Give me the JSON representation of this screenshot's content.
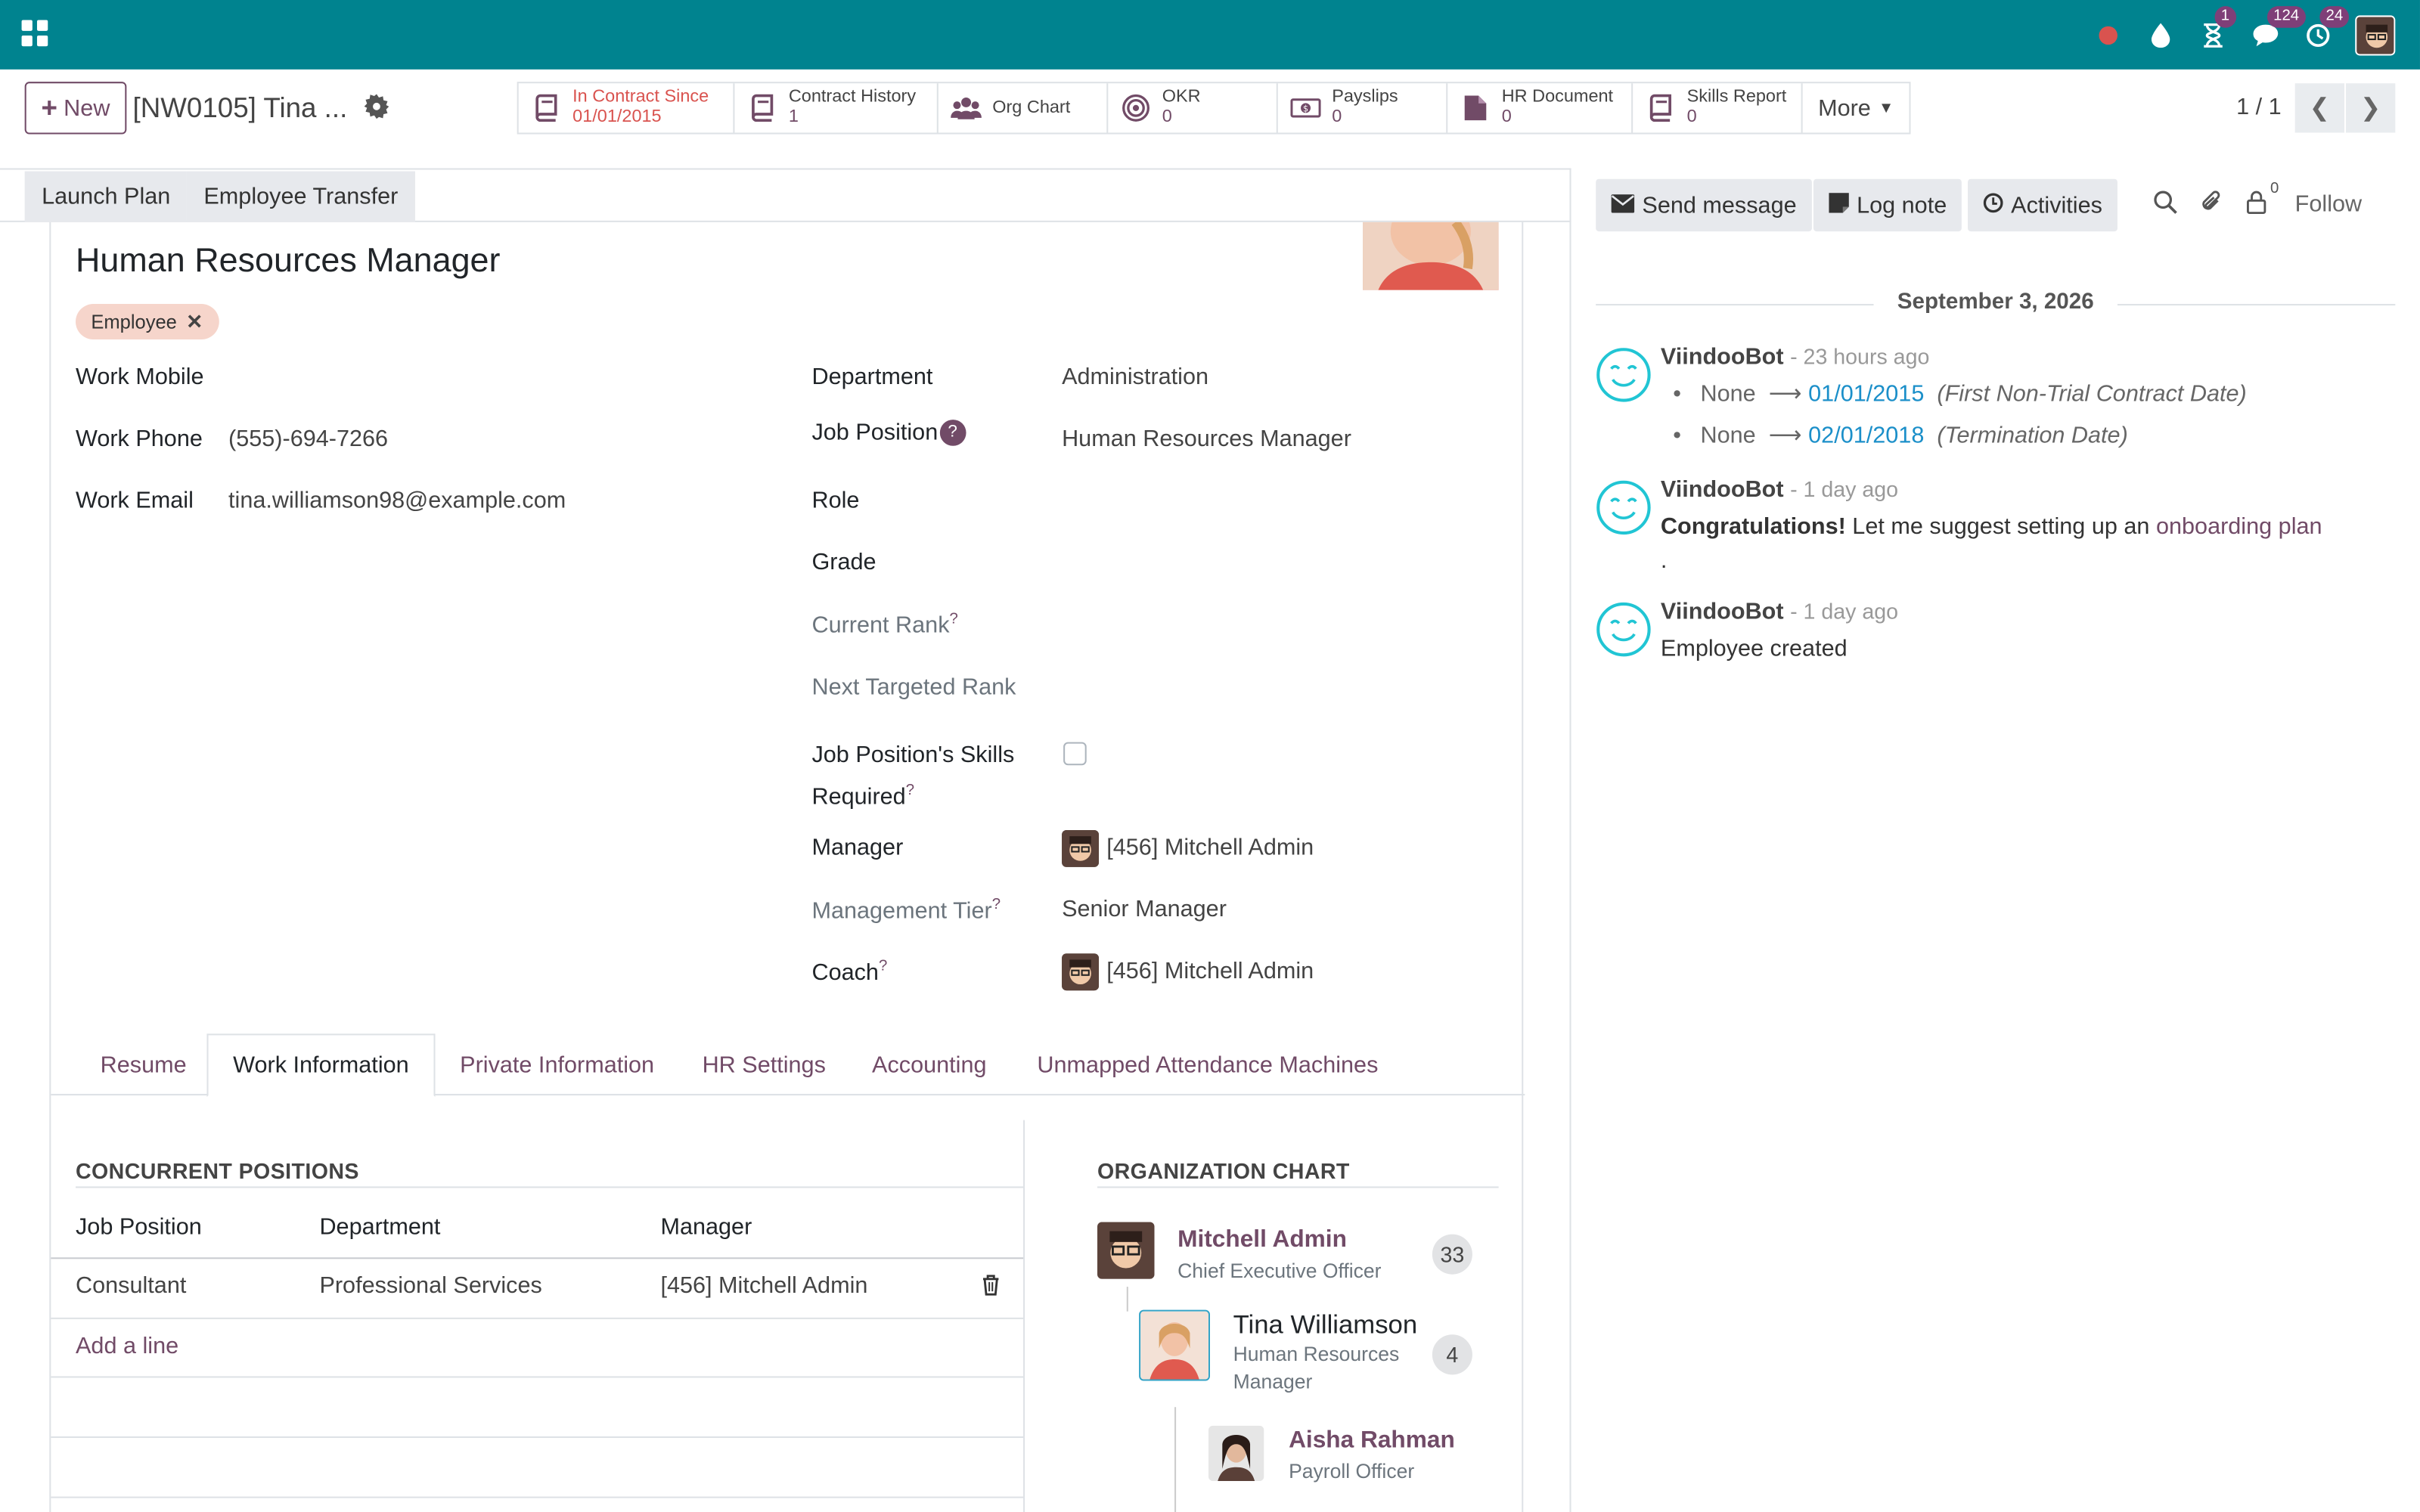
{
  "topbar": {
    "badges": {
      "activities": "1",
      "messages": "124",
      "updates": "24"
    }
  },
  "control": {
    "new_label": "New",
    "breadcrumb": "[NW0105] Tina ...",
    "smart_buttons": [
      {
        "label": "In Contract Since",
        "value": "01/01/2015"
      },
      {
        "label": "Contract History",
        "value": "1"
      },
      {
        "label": "Org Chart",
        "value": ""
      },
      {
        "label": "OKR",
        "value": "0"
      },
      {
        "label": "Payslips",
        "value": "0"
      },
      {
        "label": "HR Document",
        "value": "0"
      },
      {
        "label": "Skills Report",
        "value": "0"
      }
    ],
    "more_label": "More",
    "pager": "1 / 1"
  },
  "status_buttons": [
    "Launch Plan",
    "Employee Transfer"
  ],
  "employee": {
    "job_title": "Human Resources Manager",
    "tag": "Employee",
    "left_fields": [
      {
        "label": "Work Mobile",
        "value": ""
      },
      {
        "label": "Work Phone",
        "value": "(555)-694-7266"
      },
      {
        "label": "Work Email",
        "value": "tina.williamson98@example.com"
      }
    ],
    "right_fields": {
      "department": {
        "label": "Department",
        "value": "Administration"
      },
      "job_position": {
        "label": "Job Position",
        "value": "Human Resources Manager",
        "help": "?"
      },
      "role": {
        "label": "Role"
      },
      "grade": {
        "label": "Grade"
      },
      "current_rank": {
        "label": "Current Rank",
        "help": "?"
      },
      "next_rank": {
        "label": "Next Targeted Rank"
      },
      "skills_required": {
        "label_1": "Job Position's Skills",
        "label_2": "Required",
        "help": "?"
      },
      "manager": {
        "label": "Manager",
        "value": "[456] Mitchell Admin"
      },
      "management_tier": {
        "label": "Management Tier",
        "value": "Senior Manager",
        "help": "?"
      },
      "coach": {
        "label": "Coach",
        "value": "[456] Mitchell Admin",
        "help": "?"
      }
    }
  },
  "notebook": {
    "tabs": [
      "Resume",
      "Work Information",
      "Private Information",
      "HR Settings",
      "Accounting",
      "Unmapped Attendance Machines"
    ],
    "active_tab": "Work Information"
  },
  "concurrent_positions": {
    "title": "CONCURRENT POSITIONS",
    "headers": [
      "Job Position",
      "Department",
      "Manager"
    ],
    "rows": [
      {
        "job": "Consultant",
        "department": "Professional Services",
        "manager": "[456] Mitchell Admin"
      }
    ],
    "add_line": "Add a line"
  },
  "org_chart": {
    "title": "ORGANIZATION CHART",
    "manager": {
      "name": "Mitchell Admin",
      "title": "Chief Executive Officer",
      "count": "33"
    },
    "self": {
      "name": "Tina Williamson",
      "title_1": "Human Resources",
      "title_2": "Manager",
      "count": "4"
    },
    "subordinate": {
      "name": "Aisha Rahman",
      "title": "Payroll Officer"
    }
  },
  "chatter": {
    "send_message": "Send message",
    "log_note": "Log note",
    "activities": "Activities",
    "follower_count": "0",
    "follow": "Follow",
    "date": "September 3, 2026",
    "messages": [
      {
        "author": "ViindooBot",
        "time": "- 23 hours ago",
        "tracking": [
          {
            "old": "None",
            "new": "01/01/2015",
            "field": "(First Non-Trial Contract Date)"
          },
          {
            "old": "None",
            "new": "02/01/2018",
            "field": "(Termination Date)"
          }
        ]
      },
      {
        "author": "ViindooBot",
        "time": "- 1 day ago",
        "bold": "Congratulations!",
        "text": "Let me suggest setting up an",
        "link": "onboarding plan",
        "tail": "."
      },
      {
        "author": "ViindooBot",
        "time": "- 1 day ago",
        "text": "Employee created"
      }
    ]
  }
}
